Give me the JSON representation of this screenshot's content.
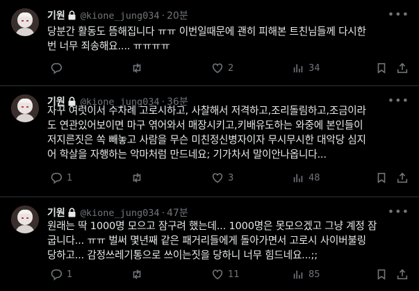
{
  "tweets": [
    {
      "name": "기원",
      "handle": "@kione_jung034",
      "separator": "·",
      "time": "20분",
      "text": "당분간 활동도 뜸해집니다 ㅠㅠ 이번일때문에 괜히 피해본 트친님들께 다시한\n번 너무 죄송해요.... ㅠㅠㅠㅠ",
      "reply_count": "",
      "retweet_count": "",
      "like_count": "2",
      "view_count": "34"
    },
    {
      "name": "기원",
      "handle": "@kione_jung034",
      "separator": "·",
      "time": "36분",
      "text": "자꾸 여럿이서 수차례 고로시하고, 사찰해서 저격하고,조리돌림하고,조금이라\n도 연관있어보이면 마구 엮어와서 매장시키고,키배유도하는 와중에 본인들이\n저지른짓은 쏙 빼놓고 사람을 무슨 미친정신병자이자 무시무시한 대악당 심지\n어 학살을 자행하는 악마처럼 만드네요; 기가차서 말이안나옵니다...",
      "reply_count": "1",
      "retweet_count": "",
      "like_count": "3",
      "view_count": "48"
    },
    {
      "name": "기원",
      "handle": "@kione_jung034",
      "separator": "·",
      "time": "47분",
      "text": "원래는 딱 1000명 모으고 잠구려 했는데... 1000명은 못모으겠고 그냥 계정 잠\n굽니다... ㅠㅠ 벌써 몇년째 같은 패거리들에게 돌아가면서 고로시 사이버불링\n당하고... 감정쓰레기통으로 쓰이는짓을 당하니 너무 힘드네요...;;",
      "reply_count": "1",
      "retweet_count": "",
      "like_count": "11",
      "view_count": "85"
    }
  ],
  "icons": {
    "more": "more-icon",
    "lock": "lock-icon",
    "reply": "reply-icon",
    "retweet": "retweet-icon",
    "like": "like-icon",
    "views": "views-icon",
    "bookmark": "bookmark-icon",
    "share": "share-icon"
  },
  "colors": {
    "background": "#000000",
    "text": "#e7e9ea",
    "muted": "#71767b",
    "border": "#2f3336"
  }
}
